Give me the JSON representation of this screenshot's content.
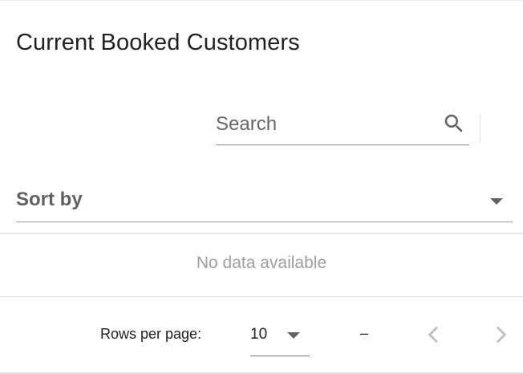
{
  "card": {
    "title": "Current Booked Customers"
  },
  "search": {
    "placeholder": "Search",
    "value": "",
    "icon": "search-icon"
  },
  "sort": {
    "label": "Sort by",
    "icon": "arrow-drop-down-icon"
  },
  "table": {
    "empty_message": "No data available"
  },
  "pagination": {
    "rows_per_page_label": "Rows per page:",
    "rows_per_page_value": "10",
    "range_text": "–",
    "prev_icon": "chevron-left-icon",
    "next_icon": "chevron-right-icon"
  },
  "colors": {
    "text_primary": "#212121",
    "text_secondary": "#616161",
    "text_disabled": "#9e9e9e",
    "divider": "#e0e0e0"
  }
}
